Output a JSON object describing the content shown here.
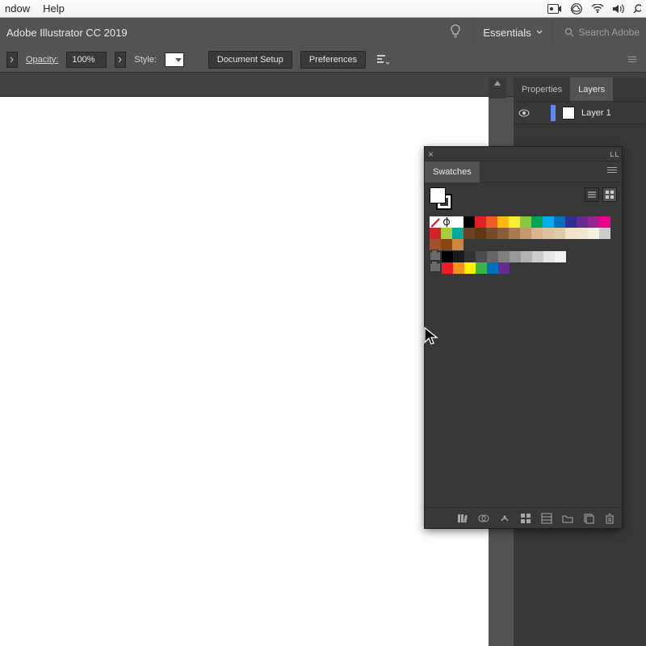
{
  "mac_menu": {
    "window": "ndow",
    "help": "Help"
  },
  "app": {
    "title": "Adobe Illustrator CC 2019",
    "workspace": "Essentials",
    "search_placeholder": "Search Adobe"
  },
  "control_bar": {
    "opacity_label": "Opacity:",
    "opacity_value": "100%",
    "style_label": "Style:",
    "doc_setup": "Document Setup",
    "preferences": "Preferences"
  },
  "right_panel": {
    "tabs": {
      "properties": "Properties",
      "layers": "Layers"
    },
    "layer_name": "Layer 1"
  },
  "swatches": {
    "title": "Swatches",
    "row1": [
      "none",
      "reg",
      "#ffffff",
      "#000000",
      "#e01f26",
      "#f15a29",
      "#fdb813",
      "#f9ed32",
      "#8dc63f",
      "#00a651",
      "#00aeef",
      "#0072bc",
      "#2e3192",
      "#662d91",
      "#92278f",
      "#ec008c"
    ],
    "row2": [
      "#d2232a",
      "#a6ce39",
      "#00a99d",
      "#6b4226",
      "#603913",
      "#754c29",
      "#8b5e3c",
      "#a97c50",
      "#c49a6c",
      "#d9b48f",
      "#dbc1a2",
      "#e0cba8",
      "#efe3c8",
      "#f1e6d0",
      "#f7f0e1",
      "#cccccc"
    ],
    "row3": [
      "#a0522d",
      "#8b4513",
      "#cd853f"
    ],
    "grays": [
      "#000000",
      "#1a1a1a",
      "#333333",
      "#4d4d4d",
      "#666666",
      "#808080",
      "#999999",
      "#b3b3b3",
      "#cccccc",
      "#e6e6e6",
      "#f2f2f2"
    ],
    "brights": [
      "#ed1c24",
      "#f7941d",
      "#fff200",
      "#39b54a",
      "#0072bc",
      "#662d91"
    ]
  }
}
